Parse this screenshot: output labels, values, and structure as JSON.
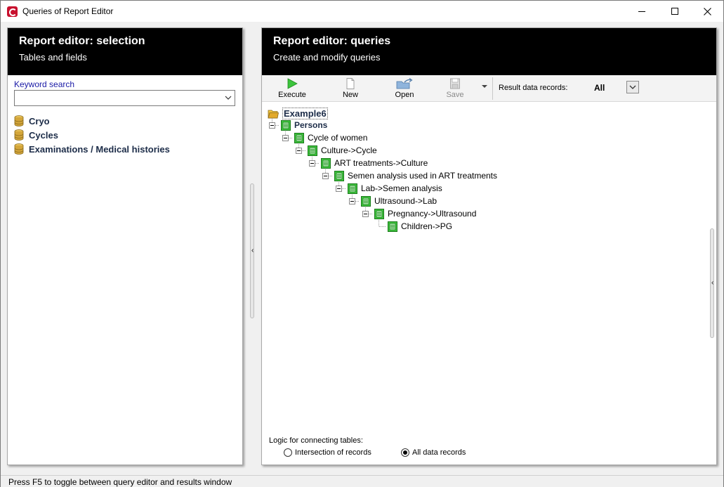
{
  "window": {
    "title": "Queries of Report Editor"
  },
  "left_panel": {
    "title": "Report editor: selection",
    "subtitle": "Tables and fields",
    "keyword_label": "Keyword search",
    "keyword_value": "",
    "tables": [
      {
        "label": "Cryo"
      },
      {
        "label": "Cycles"
      },
      {
        "label": "Examinations / Medical histories"
      }
    ]
  },
  "right_panel": {
    "title": "Report editor: queries",
    "subtitle": "Create and modify queries",
    "toolbar": {
      "execute_label": "Execute",
      "new_label": "New",
      "open_label": "Open",
      "save_label": "Save",
      "result_records_label": "Result data records:",
      "result_records_value": "All"
    },
    "tree": [
      {
        "label": "Example6",
        "level": 0,
        "icon": "folder-icon"
      },
      {
        "label": "Persons",
        "level": 1,
        "icon": "table-icon"
      },
      {
        "label": "Cycle of women",
        "level": 2,
        "icon": "table-icon"
      },
      {
        "label": "Culture->Cycle",
        "level": 3,
        "icon": "table-icon"
      },
      {
        "label": "ART treatments->Culture",
        "level": 4,
        "icon": "table-icon"
      },
      {
        "label": "Semen analysis used in ART treatments",
        "level": 5,
        "icon": "table-icon"
      },
      {
        "label": "Lab->Semen analysis",
        "level": 6,
        "icon": "table-icon"
      },
      {
        "label": "Ultrasound->Lab",
        "level": 7,
        "icon": "table-icon"
      },
      {
        "label": "Pregnancy->Ultrasound",
        "level": 8,
        "icon": "table-icon"
      },
      {
        "label": "Children->PG",
        "level": 9,
        "icon": "table-icon"
      }
    ],
    "logic": {
      "label": "Logic for connecting tables:",
      "option_intersection": "Intersection of records",
      "option_all": "All data records",
      "selected": "all"
    }
  },
  "status": {
    "text": "Press F5 to toggle between query editor and results window"
  },
  "colors": {
    "header_bg": "#000000",
    "node_green": "#2db52d",
    "db_gold": "#d4a63a",
    "label_navy": "#1c2c48"
  }
}
